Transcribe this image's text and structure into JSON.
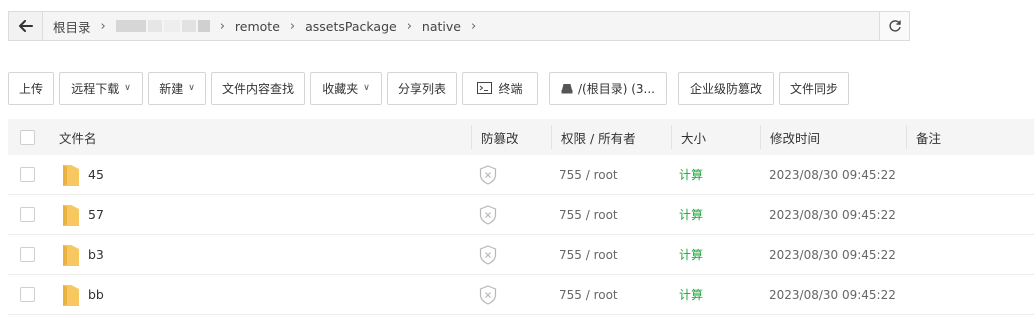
{
  "breadcrumb": {
    "root": "根目录",
    "segments": [
      "remote",
      "assetsPackage",
      "native"
    ]
  },
  "toolbar": {
    "upload": "上传",
    "remote_download": "远程下载",
    "new": "新建",
    "content_search": "文件内容查找",
    "favorites": "收藏夹",
    "share_list": "分享列表",
    "terminal": "终端",
    "disk": "/(根目录) (3...",
    "tamper_proof": "企业级防篡改",
    "file_sync": "文件同步"
  },
  "table": {
    "headers": {
      "name": "文件名",
      "tamper": "防篡改",
      "perm_owner": "权限 / 所有者",
      "size": "大小",
      "mtime": "修改时间",
      "note": "备注"
    },
    "rows": [
      {
        "name": "45",
        "perm": "755 / root",
        "size": "计算",
        "mtime": "2023/08/30 09:45:22"
      },
      {
        "name": "57",
        "perm": "755 / root",
        "size": "计算",
        "mtime": "2023/08/30 09:45:22"
      },
      {
        "name": "b3",
        "perm": "755 / root",
        "size": "计算",
        "mtime": "2023/08/30 09:45:22"
      },
      {
        "name": "bb",
        "perm": "755 / root",
        "size": "计算",
        "mtime": "2023/08/30 09:45:22"
      }
    ]
  },
  "colors": {
    "accent_green": "#20a53a",
    "folder_yellow": "#f6c85f"
  },
  "icons": {
    "back": "arrow-left-icon",
    "refresh": "refresh-icon",
    "terminal": "terminal-icon",
    "disk": "disk-icon",
    "folder": "folder-icon",
    "shield": "shield-x-icon"
  }
}
